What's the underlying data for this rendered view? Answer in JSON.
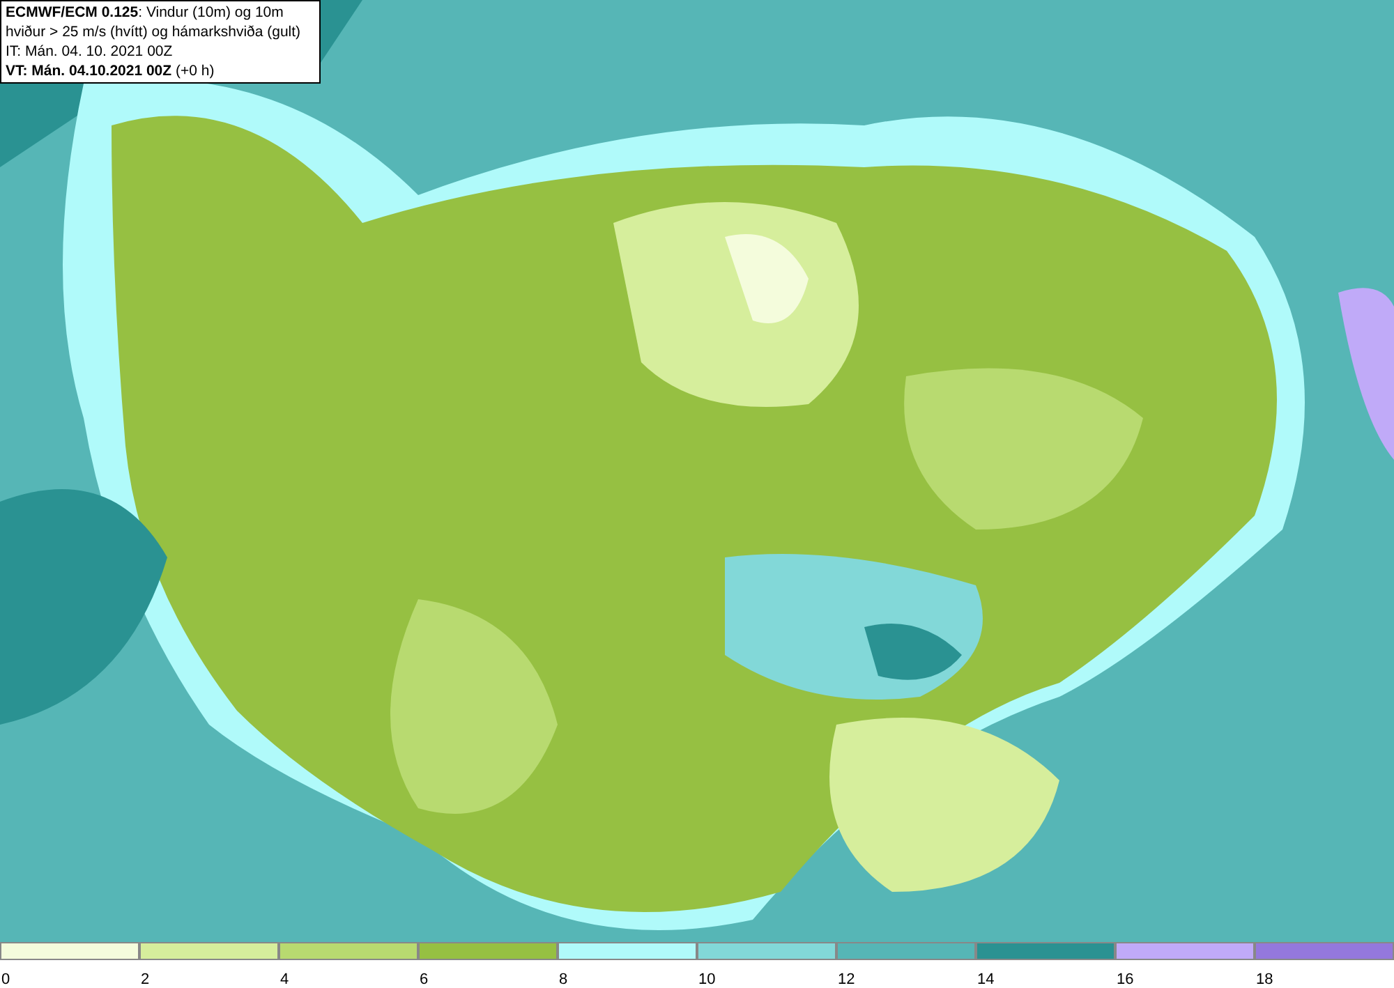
{
  "header": {
    "lines": [
      "**ECMWF/ECM 0.125**: Vindur (10m) og 10m",
      "hviður > 25 m/s (hvítt) og hámarkshviða (gult)",
      "IT: Mán. 04. 10. 2021 00Z",
      "**VT: Mán. 04.10.2021 00Z** (+0 h)"
    ]
  },
  "legend": [
    {
      "label": "0",
      "color": "#f4fcdc"
    },
    {
      "label": "2",
      "color": "#d6ee9c"
    },
    {
      "label": "4",
      "color": "#b8da70"
    },
    {
      "label": "6",
      "color": "#96c042"
    },
    {
      "label": "8",
      "color": "#b0fafa"
    },
    {
      "label": "10",
      "color": "#82d8d8"
    },
    {
      "label": "12",
      "color": "#56b6b6"
    },
    {
      "label": "14",
      "color": "#2a9292"
    },
    {
      "label": "16",
      "color": "#c0aaf8"
    },
    {
      "label": "18",
      "color": "#9478dc"
    }
  ]
}
